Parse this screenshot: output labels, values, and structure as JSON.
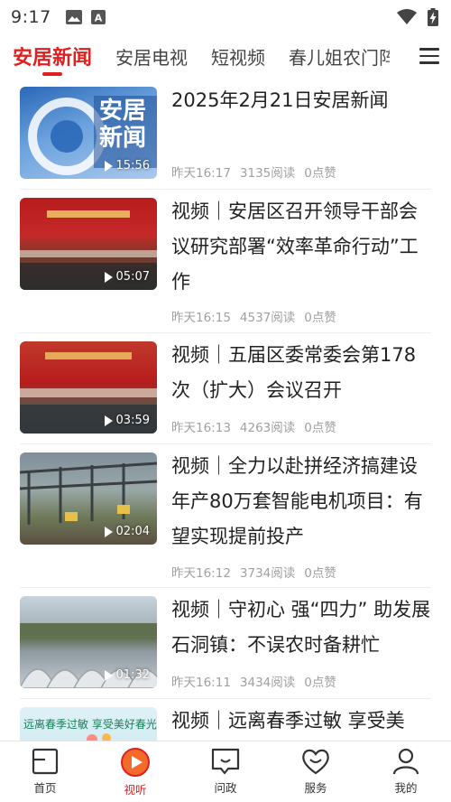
{
  "status_bar": {
    "time": "9:17",
    "icon_a_letter": "A"
  },
  "channels": [
    {
      "label": "安居新闻",
      "active": true
    },
    {
      "label": "安居电视",
      "active": false
    },
    {
      "label": "短视频",
      "active": false
    },
    {
      "label": "春儿姐农门阵",
      "active": false
    }
  ],
  "feed": [
    {
      "title": "2025年2月21日安居新闻",
      "duration": "15:56",
      "time": "昨天16:17",
      "reads": "3135阅读",
      "likes": "0点赞",
      "thumb_text": "安居新闻"
    },
    {
      "title": "视频｜安居区召开领导干部会议研究部署“效率革命行动”工作",
      "duration": "05:07",
      "time": "昨天16:15",
      "reads": "4537阅读",
      "likes": "0点赞"
    },
    {
      "title": "视频｜五届区委常委会第178次（扩大）会议召开",
      "duration": "03:59",
      "time": "昨天16:13",
      "reads": "4263阅读",
      "likes": "0点赞"
    },
    {
      "title": "视频｜全力以赴拼经济搞建设 年产80万套智能电机项目：有望实现提前投产",
      "duration": "02:04",
      "time": "昨天16:12",
      "reads": "3734阅读",
      "likes": "0点赞"
    },
    {
      "title": "视频｜守初心 强“四力” 助发展 石洞镇：不误农时备耕忙",
      "duration": "01:32",
      "time": "昨天16:11",
      "reads": "3434阅读",
      "likes": "0点赞"
    },
    {
      "title": "视频｜远离春季过敏 享受美",
      "thumb_text": "远离春季过敏 享受美好春光"
    }
  ],
  "bottom_nav": [
    {
      "label": "首页",
      "icon": "home-icon",
      "active": false
    },
    {
      "label": "视听",
      "icon": "play-circle-icon",
      "active": true
    },
    {
      "label": "问政",
      "icon": "chat-icon",
      "active": false
    },
    {
      "label": "服务",
      "icon": "heart-icon",
      "active": false
    },
    {
      "label": "我的",
      "icon": "user-icon",
      "active": false
    }
  ],
  "colors": {
    "accent": "#e02020",
    "text": "#222222",
    "meta": "#a0a0a0"
  }
}
